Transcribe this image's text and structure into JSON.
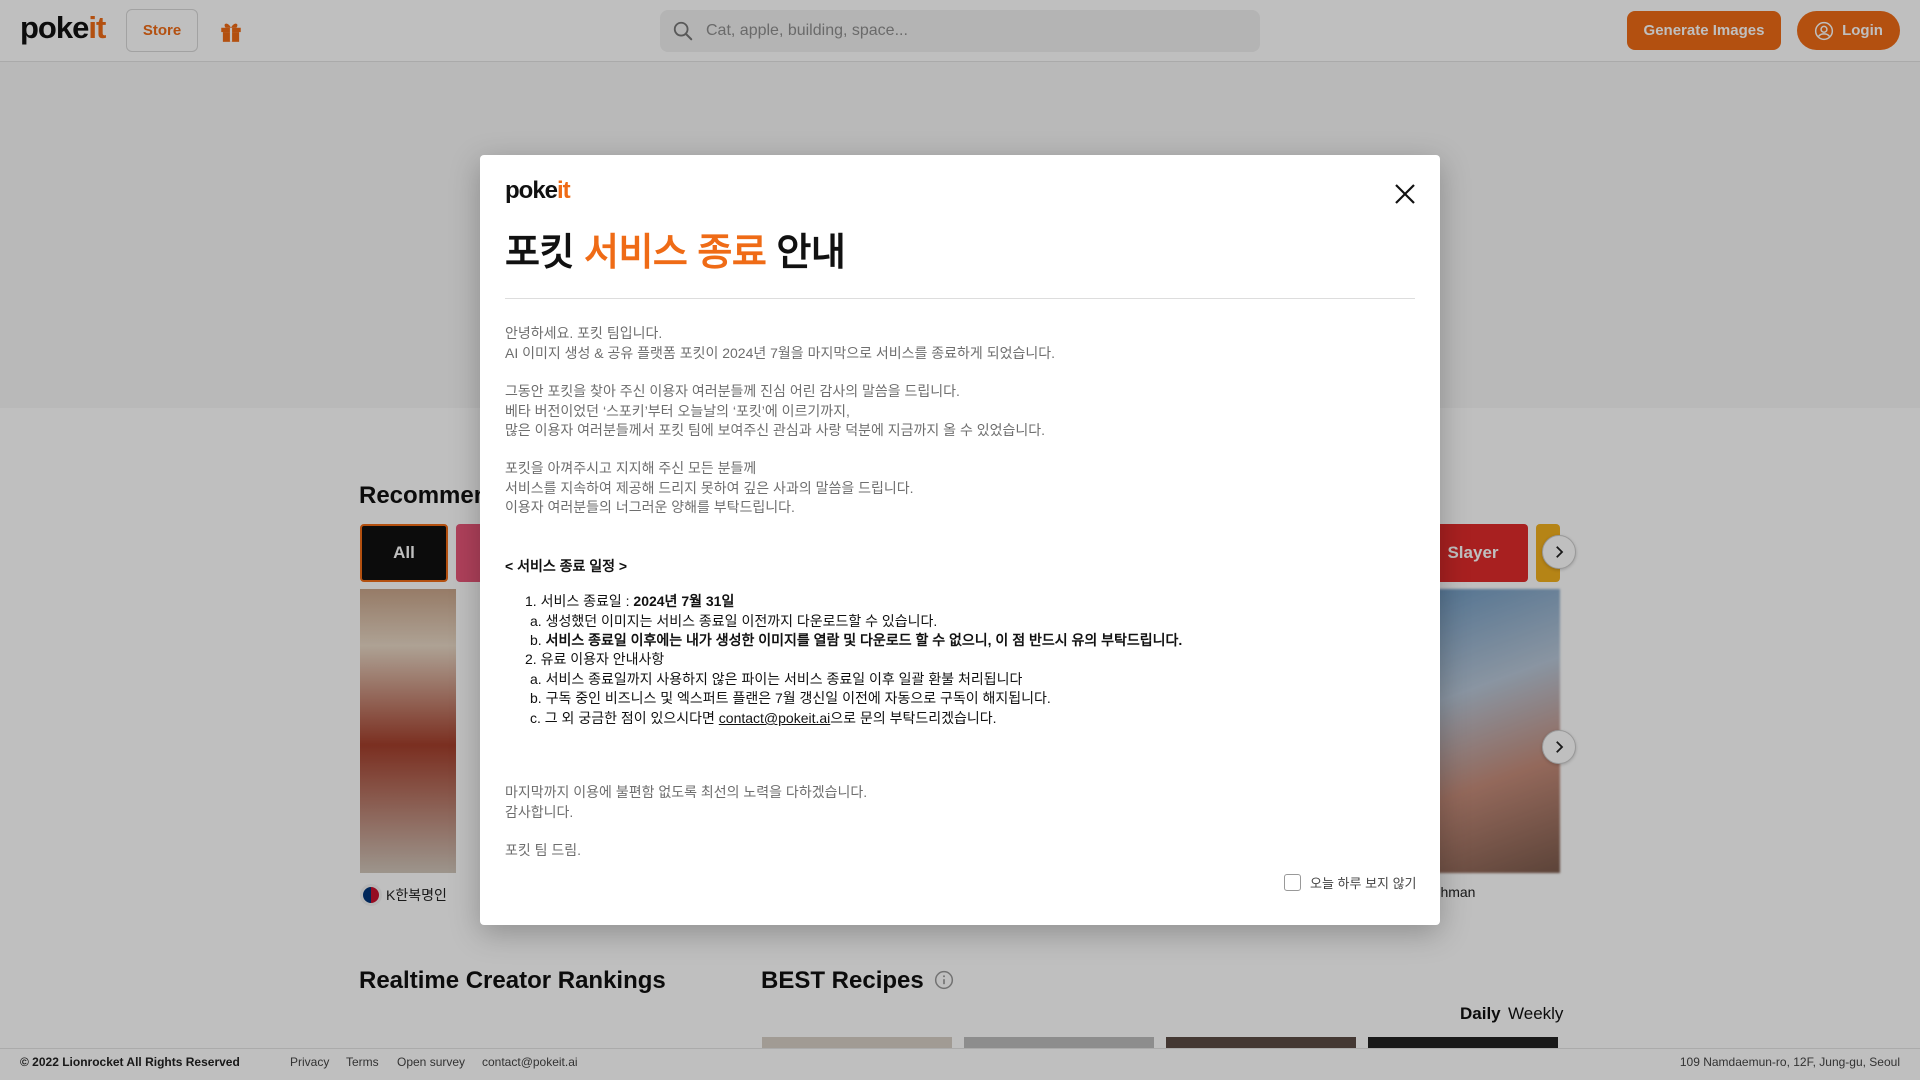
{
  "header": {
    "logo_prefix": "poke",
    "logo_accent": "it",
    "store_label": "Store",
    "gift_icon": "gift-icon",
    "search_placeholder": "Cat, apple, building, space...",
    "generate_label": "Generate Images",
    "login_label": "Login"
  },
  "background": {
    "recommend_title": "Recommen",
    "chips": [
      "All",
      "Slayer"
    ],
    "creator_left": "K한복명인",
    "creator_right": "rohman",
    "rankings_title": "Realtime Creator Rankings",
    "recipes_title": "BEST Recipes",
    "tabs": [
      "Daily",
      "Weekly"
    ]
  },
  "modal": {
    "logo_prefix": "poke",
    "logo_accent": "it",
    "title_prefix": "포킷",
    "title_highlight": "서비스 종료",
    "title_suffix": "안내",
    "paragraph1": [
      "안녕하세요. 포킷 팀입니다.",
      "AI 이미지 생성 & 공유 플랫폼 포킷이 2024년 7월을 마지막으로 서비스를 종료하게 되었습니다."
    ],
    "paragraph2": [
      "그동안 포킷을 찾아 주신 이용자 여러분들께 진심 어린 감사의 말씀을 드립니다.",
      "베타 버전이었던 ‘스포키’부터 오늘날의 ‘포킷’에 이르기까지,",
      "많은 이용자 여러분들께서 포킷 팀에 보여주신 관심과 사랑 덕분에 지금까지 올 수 있었습니다."
    ],
    "paragraph3": [
      "포킷을 아껴주시고 지지해 주신 모든 분들께",
      "서비스를 지속하여 제공해 드리지 못하여 깊은 사과의 말씀을 드립니다.",
      "이용자 여러분들의 너그러운 양해를 부탁드립니다."
    ],
    "schedule_title": "< 서비스 종료 일정 >",
    "item1_prefix": "1. 서비스 종료일 : ",
    "item1_date": "2024년 7월 31일",
    "item1a": "a. 생성했던 이미지는 서비스 종료일 이전까지 다운로드할 수 있습니다.",
    "item1b_prefix": "b. ",
    "item1b_bold": "서비스 종료일 이후에는 내가 생성한 이미지를 열람 및 다운로드 할 수 없으니, 이 점 반드시 유의 부탁드립니다.",
    "item2": "2. 유료 이용자 안내사항",
    "item2a": "a. 서비스 종료일까지 사용하지 않은 파이는 서비스 종료일 이후 일괄 환불 처리됩니다",
    "item2b": "b. 구독 중인 비즈니스 및 엑스퍼트 플랜은 7월 갱신일 이전에 자동으로 구독이 해지됩니다.",
    "item2c_prefix": "c. 그 외 궁금한 점이 있으시다면 ",
    "item2c_link": "contact@pokeit.ai",
    "item2c_suffix": "으로 문의 부탁드리겠습니다.",
    "closing": [
      "마지막까지 이용에 불편함 없도록 최선의 노력을 다하겠습니다.",
      "감사합니다."
    ],
    "signature": "포킷 팀 드림.",
    "hide_today_label": "오늘 하루 보지 않기"
  },
  "footer": {
    "copyright": "© 2022 Lionrocket All Rights Reserved",
    "links": [
      "Privacy",
      "Terms",
      "Open survey",
      "contact@pokeit.ai"
    ],
    "address": "109 Namdaemun-ro, 12F, Jung-gu, Seoul"
  }
}
